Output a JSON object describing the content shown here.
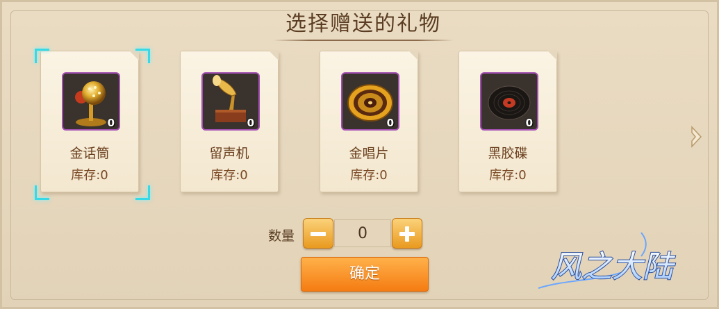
{
  "dialog": {
    "title": "选择赠送的礼物"
  },
  "gifts": [
    {
      "name": "金话筒",
      "stock_label": "库存:0",
      "count": "0",
      "icon": "golden-microphone-icon"
    },
    {
      "name": "留声机",
      "stock_label": "库存:0",
      "count": "0",
      "icon": "gramophone-icon"
    },
    {
      "name": "金唱片",
      "stock_label": "库存:0",
      "count": "0",
      "icon": "gold-record-icon"
    },
    {
      "name": "黑胶碟",
      "stock_label": "库存:0",
      "count": "0",
      "icon": "vinyl-record-icon"
    }
  ],
  "selected_index": 0,
  "quantity": {
    "label": "数量",
    "value": "0"
  },
  "confirm_label": "确定",
  "logo_text": "风之大陆",
  "colors": {
    "selection": "#38d9e6",
    "slot_border": "#a24fb2",
    "button_orange": "#f47c12"
  }
}
